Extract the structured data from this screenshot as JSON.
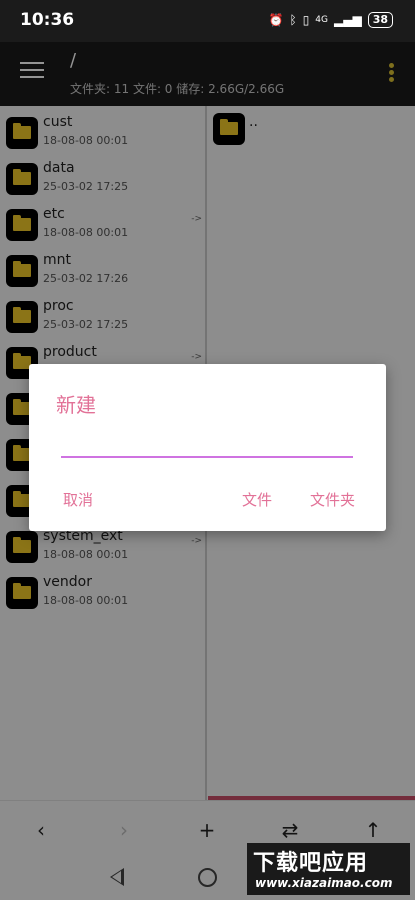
{
  "status_bar": {
    "time": "10:36",
    "network": "4G",
    "battery": "38"
  },
  "app_bar": {
    "path": "/",
    "info": "文件夹: 11  文件: 0  储存: 2.66G/2.66G"
  },
  "left_pane": {
    "items": [
      {
        "name": "cust",
        "date": "18-08-08 00:01",
        "is_link": false
      },
      {
        "name": "data",
        "date": "25-03-02 17:25",
        "is_link": false
      },
      {
        "name": "etc",
        "date": "18-08-08 00:01",
        "is_link": true,
        "link_mark": "->"
      },
      {
        "name": "mnt",
        "date": "25-03-02 17:26",
        "is_link": false
      },
      {
        "name": "proc",
        "date": "25-03-02 17:25",
        "is_link": false
      },
      {
        "name": "product",
        "date": "",
        "is_link": true,
        "link_mark": "->"
      },
      {
        "name": "",
        "date": "",
        "is_link": false
      },
      {
        "name": "",
        "date": "",
        "is_link": false
      },
      {
        "name": "",
        "date": "",
        "is_link": false
      },
      {
        "name": "system_ext",
        "date": "18-08-08 00:01",
        "is_link": true,
        "link_mark": "->"
      },
      {
        "name": "vendor",
        "date": "18-08-08 00:01",
        "is_link": false
      }
    ]
  },
  "right_pane": {
    "parent_label": ".."
  },
  "dialog": {
    "title": "新建",
    "input_value": "",
    "cancel_label": "取消",
    "file_label": "文件",
    "folder_label": "文件夹"
  },
  "toolbar": {
    "back_icon": "chevron-left-icon",
    "forward_icon": "chevron-right-icon",
    "add_icon": "plus-icon",
    "swap_icon": "swap-icon",
    "up_icon": "arrow-up-icon"
  },
  "watermark": {
    "title": "下载吧应用",
    "url": "www.xiazaimao.com"
  },
  "colors": {
    "accent": "#e27197",
    "folder": "#f0c929",
    "indicator": "#c94f68",
    "input_line": "#cf73e1"
  }
}
